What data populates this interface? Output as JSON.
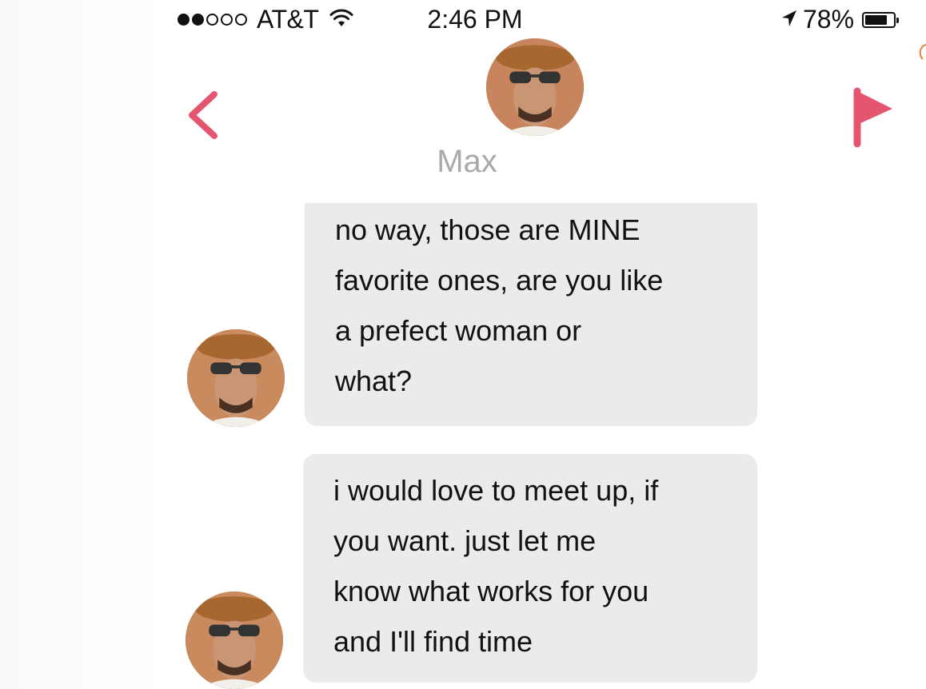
{
  "status_bar": {
    "signal_filled": 2,
    "signal_total": 5,
    "carrier": "AT&T",
    "time": "2:46 PM",
    "battery_percent": "78%",
    "battery_level": 0.78,
    "icons": [
      "signal-dots-icon",
      "wifi-icon",
      "location-arrow-icon",
      "battery-icon"
    ]
  },
  "header": {
    "contact_name": "Max",
    "back_icon": "chevron-left-icon",
    "report_icon": "flag-icon",
    "accent_color": "#e4566f"
  },
  "messages": [
    {
      "sender": "Max",
      "lines": [
        "no way, those are MINE",
        "favorite ones, are you like",
        "a prefect woman or",
        "what?"
      ]
    },
    {
      "sender": "Max",
      "lines": [
        "i would love to meet up, if",
        "you want. just let me",
        "know what works for you",
        "and I'll find time"
      ]
    }
  ],
  "colors": {
    "bubble_bg": "#ebebeb",
    "name_gray": "#a9a9a9",
    "accent": "#e4566f"
  }
}
